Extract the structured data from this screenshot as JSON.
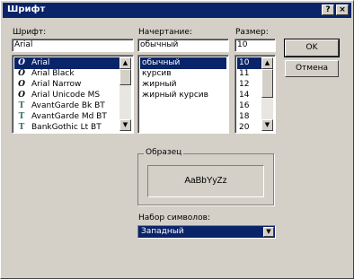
{
  "title": "Шрифт",
  "title_buttons": {
    "help": "?",
    "close": "×"
  },
  "labels": {
    "font": "Шрифт:",
    "style": "Начертание:",
    "size": "Размер:"
  },
  "font_input": "Arial",
  "style_input": "обычный",
  "size_input": "10",
  "fonts": [
    {
      "name": "Arial",
      "icon": "O",
      "selected": true
    },
    {
      "name": "Arial Black",
      "icon": "O",
      "selected": false
    },
    {
      "name": "Arial Narrow",
      "icon": "O",
      "selected": false
    },
    {
      "name": "Arial Unicode MS",
      "icon": "O",
      "selected": false
    },
    {
      "name": "AvantGarde Bk BT",
      "icon": "T",
      "selected": false
    },
    {
      "name": "AvantGarde Md BT",
      "icon": "T",
      "selected": false
    },
    {
      "name": "BankGothic Lt BT",
      "icon": "T",
      "selected": false
    }
  ],
  "styles": [
    {
      "name": "обычный",
      "selected": true
    },
    {
      "name": "курсив",
      "selected": false
    },
    {
      "name": "жирный",
      "selected": false
    },
    {
      "name": "жирный курсив",
      "selected": false
    }
  ],
  "sizes": [
    {
      "name": "10",
      "selected": true
    },
    {
      "name": "11",
      "selected": false
    },
    {
      "name": "12",
      "selected": false
    },
    {
      "name": "14",
      "selected": false
    },
    {
      "name": "16",
      "selected": false
    },
    {
      "name": "18",
      "selected": false
    },
    {
      "name": "20",
      "selected": false
    }
  ],
  "buttons": {
    "ok": "OK",
    "cancel": "Отмена"
  },
  "sample": {
    "label": "Образец",
    "text": "AaBbYyZz"
  },
  "charset": {
    "label": "Набор символов:",
    "value": "Западный"
  },
  "colors": {
    "selection": "#0a246a",
    "face": "#d4d0c8"
  }
}
